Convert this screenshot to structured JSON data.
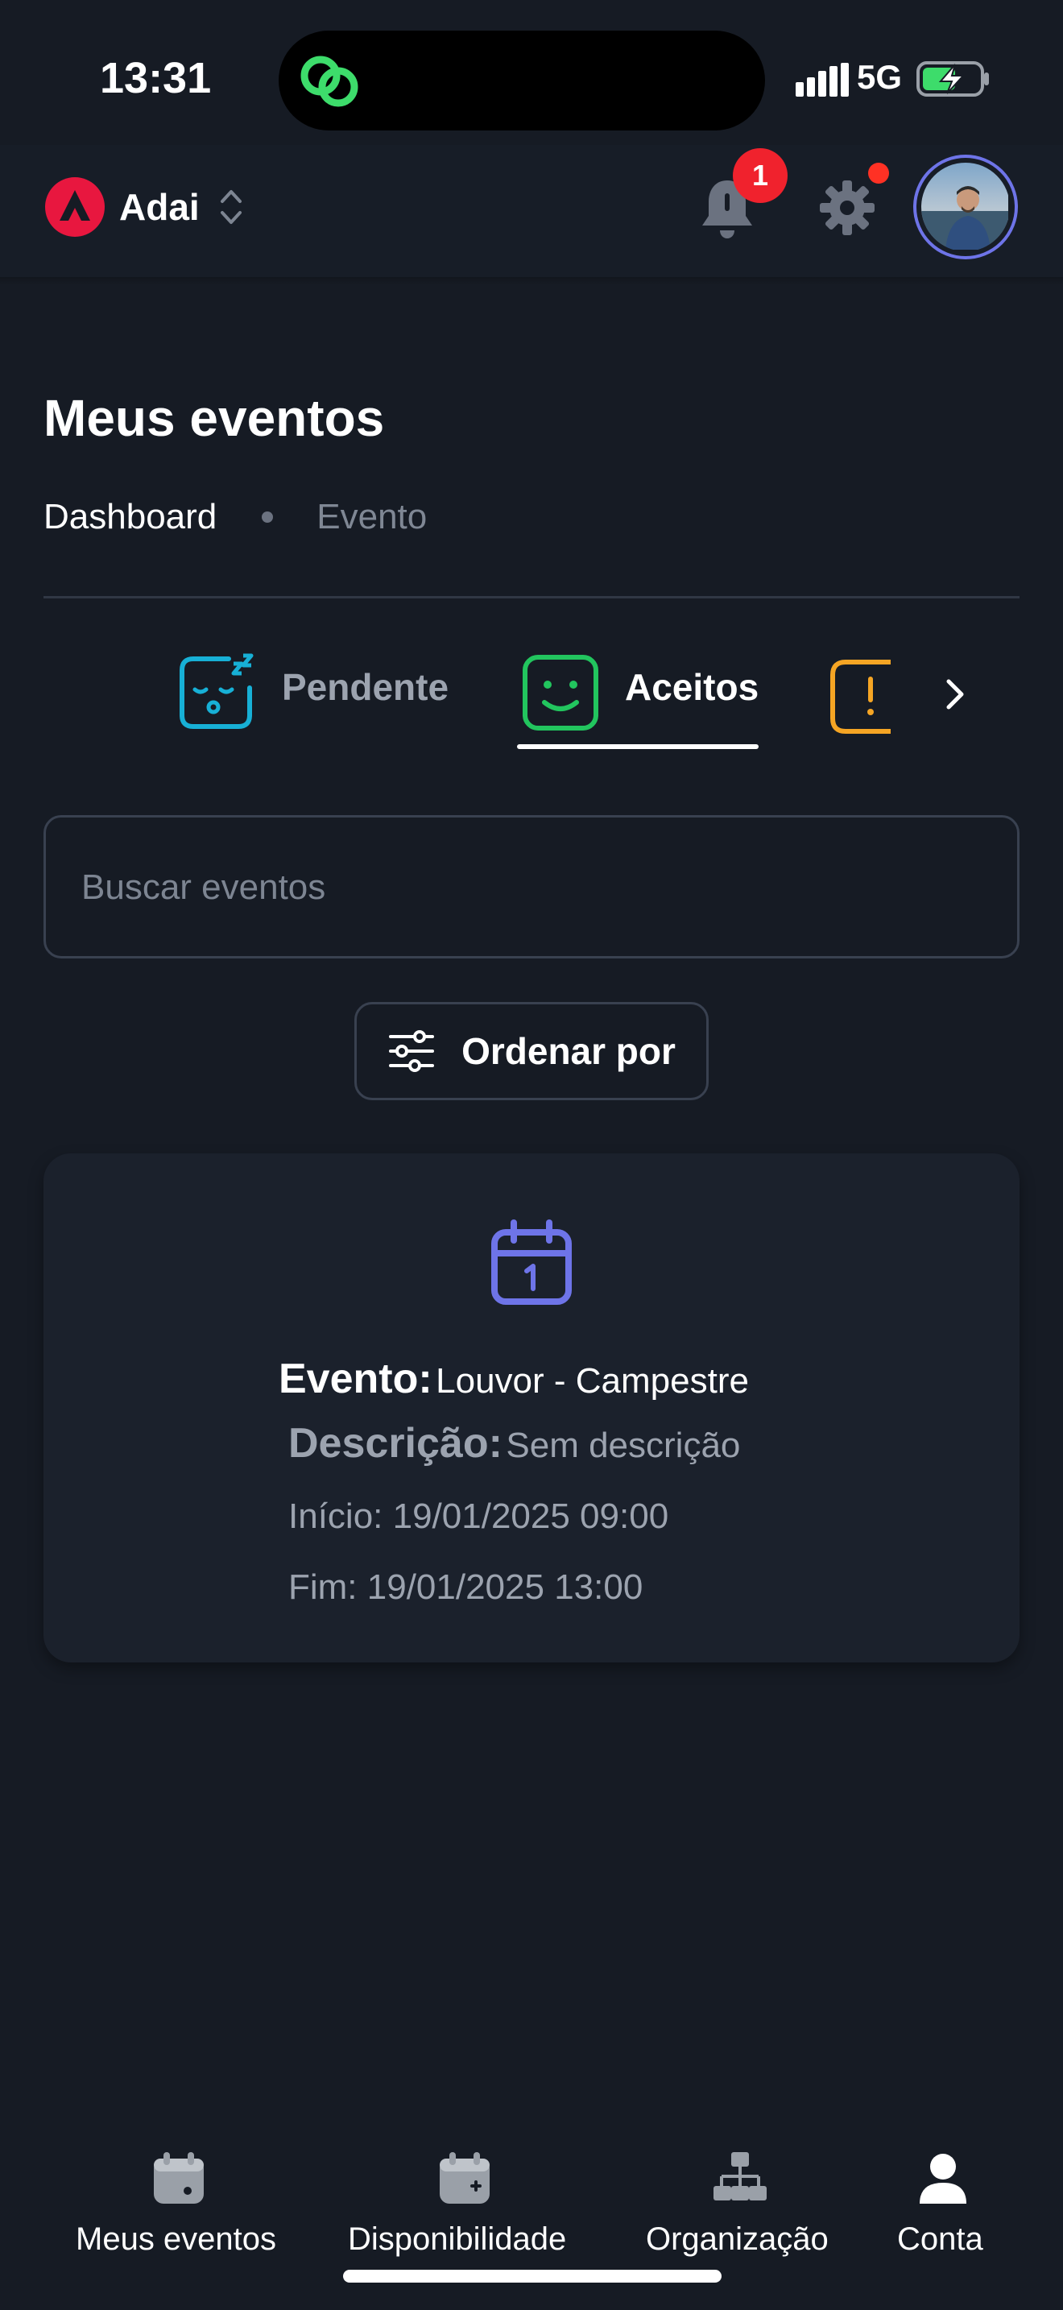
{
  "status_bar": {
    "time": "13:31",
    "network": "5G"
  },
  "header": {
    "org_name": "Adai",
    "notification_count": "1"
  },
  "page": {
    "title": "Meus eventos",
    "breadcrumb": [
      "Dashboard",
      "Evento"
    ]
  },
  "tabs": [
    {
      "label": "Pendente",
      "icon": "sleepy-face-icon",
      "color": "#17b0d6"
    },
    {
      "label": "Aceitos",
      "icon": "smile-face-icon",
      "color": "#22c55e",
      "active": true
    },
    {
      "label": "",
      "icon": "alert-icon",
      "color": "#f5a524"
    }
  ],
  "search": {
    "placeholder": "Buscar eventos",
    "value": ""
  },
  "sort": {
    "label": "Ordenar por"
  },
  "event": {
    "title_label": "Evento:",
    "title_value": "Louvor - Campestre",
    "desc_label": "Descrição:",
    "desc_value": "Sem descrição",
    "start": "Início: 19/01/2025 09:00",
    "end": "Fim: 19/01/2025 13:00",
    "icon_color": "#6e74e8"
  },
  "bottom_nav": [
    {
      "label": "Meus eventos",
      "icon": "calendar-icon"
    },
    {
      "label": "Disponibilidade",
      "icon": "calendar-add-icon"
    },
    {
      "label": "Organização",
      "icon": "org-chart-icon"
    },
    {
      "label": "Conta",
      "icon": "user-icon"
    }
  ],
  "colors": {
    "background": "#161b24",
    "card": "#1b212c",
    "accent": "#6e74e8",
    "badge": "#f0222d"
  }
}
